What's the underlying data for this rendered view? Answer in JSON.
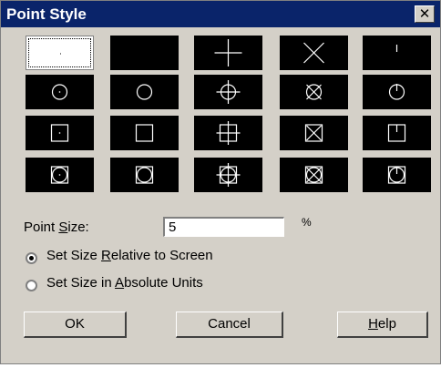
{
  "window": {
    "title": "Point Style",
    "close_glyph": "✕"
  },
  "styles": [
    {
      "name": "point-style-dot",
      "icon": "dot",
      "selected": true
    },
    {
      "name": "point-style-none",
      "icon": "none"
    },
    {
      "name": "point-style-plus",
      "icon": "plus"
    },
    {
      "name": "point-style-x",
      "icon": "x"
    },
    {
      "name": "point-style-tick",
      "icon": "tick"
    },
    {
      "name": "point-style-circle-dot",
      "icon": "circle-dot"
    },
    {
      "name": "point-style-circle",
      "icon": "circle"
    },
    {
      "name": "point-style-circle-plus",
      "icon": "circle-plus"
    },
    {
      "name": "point-style-circle-x",
      "icon": "circle-x"
    },
    {
      "name": "point-style-circle-tick",
      "icon": "circle-tick"
    },
    {
      "name": "point-style-square-dot",
      "icon": "square-dot"
    },
    {
      "name": "point-style-square",
      "icon": "square"
    },
    {
      "name": "point-style-square-plus",
      "icon": "square-plus"
    },
    {
      "name": "point-style-square-x",
      "icon": "square-x"
    },
    {
      "name": "point-style-square-tick",
      "icon": "square-tick"
    },
    {
      "name": "point-style-square-circle-dot",
      "icon": "square-circle-dot"
    },
    {
      "name": "point-style-square-circle",
      "icon": "square-circle"
    },
    {
      "name": "point-style-square-circle-plus",
      "icon": "square-circle-plus"
    },
    {
      "name": "point-style-square-circle-x",
      "icon": "square-circle-x"
    },
    {
      "name": "point-style-square-circle-tick",
      "icon": "square-circle-tick"
    }
  ],
  "size": {
    "label_pre": "Point ",
    "label_key": "S",
    "label_post": "ize:",
    "value": "5",
    "unit": "%"
  },
  "options": {
    "relative": {
      "pre": "Set Size ",
      "key": "R",
      "post": "elative to Screen",
      "checked": true
    },
    "absolute": {
      "pre": "Set Size in ",
      "key": "A",
      "post": "bsolute Units",
      "checked": false
    }
  },
  "buttons": {
    "ok": "OK",
    "cancel": "Cancel",
    "help_key": "H",
    "help_post": "elp"
  },
  "colors": {
    "titlebar": "#0a246a",
    "face": "#d4d0c8",
    "tile": "#000000",
    "glyph": "#ffffff"
  }
}
